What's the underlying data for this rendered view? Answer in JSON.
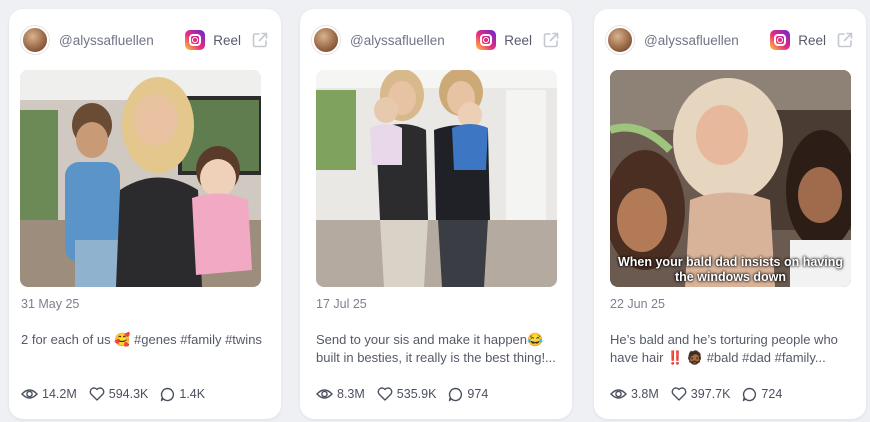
{
  "posts": [
    {
      "handle": "@alyssafluellen",
      "platform_label": "Reel",
      "date": "31 May 25",
      "description": "2 for each of us 🥰 #genes #family #twins",
      "views": "14.2M",
      "likes": "594.3K",
      "comments": "1.4K",
      "overlay_text": ""
    },
    {
      "handle": "@alyssafluellen",
      "platform_label": "Reel",
      "date": "17 Jul 25",
      "description": "Send to your sis and make it happen😂 built in besties, it really is the best thing!...",
      "views": "8.3M",
      "likes": "535.9K",
      "comments": "974",
      "overlay_text": ""
    },
    {
      "handle": "@alyssafluellen",
      "platform_label": "Reel",
      "date": "22 Jun 25",
      "description": "He’s bald and he’s torturing people who have hair ‼️ 🧔🏾 #bald #dad #family...",
      "views": "3.8M",
      "likes": "397.7K",
      "comments": "724",
      "overlay_text": "When your bald dad insists on having the windows down"
    }
  ],
  "icons": {
    "platform": "instagram-icon",
    "external": "external-link-icon",
    "views": "eye-icon",
    "likes": "heart-icon",
    "comments": "comment-icon"
  },
  "colors": {
    "background": "#eef0f4",
    "card": "#ffffff",
    "muted_text": "#7b8191"
  }
}
